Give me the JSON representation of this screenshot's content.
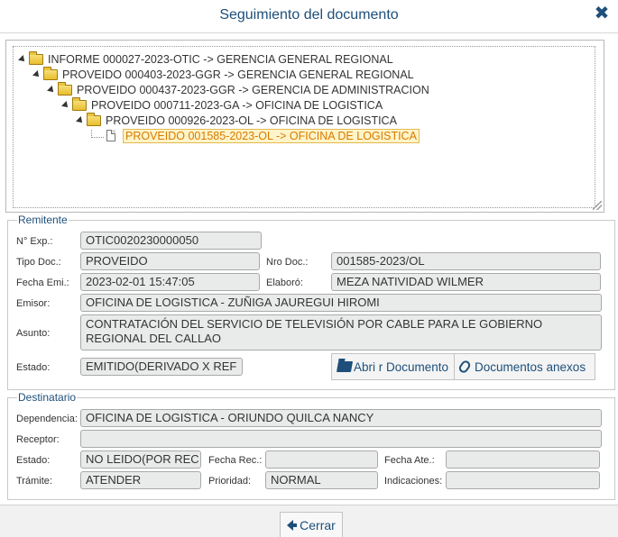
{
  "window": {
    "title": "Seguimiento del documento",
    "close_icon": "close-icon"
  },
  "tree": [
    {
      "label": "INFORME 000027-2023-OTIC -> GERENCIA GENERAL REGIONAL",
      "level": 0,
      "icon": "folder-icon",
      "selected": false
    },
    {
      "label": "PROVEIDO 000403-2023-GGR -> GERENCIA GENERAL REGIONAL",
      "level": 1,
      "icon": "folder-icon",
      "selected": false
    },
    {
      "label": "PROVEIDO 000437-2023-GGR -> GERENCIA DE ADMINISTRACION",
      "level": 2,
      "icon": "folder-icon",
      "selected": false
    },
    {
      "label": "PROVEIDO 000711-2023-GA -> OFICINA DE LOGISTICA",
      "level": 3,
      "icon": "folder-icon",
      "selected": false
    },
    {
      "label": "PROVEIDO 000926-2023-OL -> OFICINA DE LOGISTICA",
      "level": 4,
      "icon": "folder-icon",
      "selected": false
    },
    {
      "label": "PROVEIDO 001585-2023-OL -> OFICINA DE LOGISTICA",
      "level": 5,
      "icon": "document-icon",
      "selected": true
    }
  ],
  "remitente": {
    "legend": "Remitente",
    "exp_label": "N° Exp.:",
    "exp_value": "OTIC0020230000050",
    "tipo_label": "Tipo Doc.:",
    "tipo_value": "PROVEIDO",
    "nro_label": "Nro Doc.:",
    "nro_value": "001585-2023/OL",
    "fecha_label": "Fecha Emi.:",
    "fecha_value": "2023-02-01 15:47:05",
    "elaboro_label": "Elaboró:",
    "elaboro_value": "MEZA NATIVIDAD WILMER",
    "emisor_label": "Emisor:",
    "emisor_value": "OFICINA DE LOGISTICA - ZUÑIGA JAUREGUI HIROMI",
    "asunto_label": "Asunto:",
    "asunto_value": "CONTRATACIÓN DEL SERVICIO DE TELEVISIÓN POR CABLE  PARA LE GOBIERNO REGIONAL DEL CALLAO",
    "estado_label": "Estado:",
    "estado_value": "EMITIDO(DERIVADO X REF",
    "abrir_label": "Abri r Documento",
    "anexos_label": "Documentos anexos"
  },
  "destinatario": {
    "legend": "Destinatario",
    "dependencia_label": "Dependencia:",
    "dependencia_value": "OFICINA DE LOGISTICA - ORIUNDO QUILCA NANCY",
    "receptor_label": "Receptor:",
    "receptor_value": "",
    "estado_label": "Estado:",
    "estado_value": "NO LEIDO(POR REC",
    "fecha_rec_label": "Fecha Rec.:",
    "fecha_rec_value": "",
    "fecha_ate_label": "Fecha Ate.:",
    "fecha_ate_value": "",
    "tramite_label": "Trámite:",
    "tramite_value": "ATENDER",
    "prioridad_label": "Prioridad:",
    "prioridad_value": "NORMAL",
    "indicaciones_label": "Indicaciones:",
    "indicaciones_value": ""
  },
  "footer": {
    "cerrar_label": "Cerrar"
  }
}
